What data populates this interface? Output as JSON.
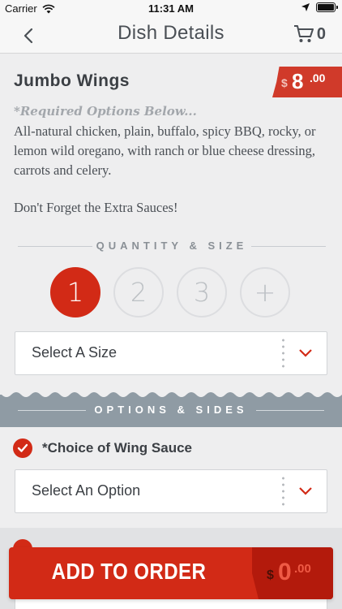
{
  "status_bar": {
    "carrier": "Carrier",
    "time": "11:31 AM"
  },
  "nav": {
    "title": "Dish Details",
    "cart_count": "0"
  },
  "dish": {
    "name": "Jumbo Wings",
    "price_currency": "$",
    "price_whole": "8",
    "price_cents": ".00",
    "required_note": "*Required Options Below...",
    "description": "All-natural chicken, plain, buffalo, spicy BBQ, rocky, or lemon wild oregano, with ranch or blue cheese dressing, carrots and celery.",
    "extra_note": "Don't Forget the Extra Sauces!"
  },
  "quantity": {
    "header": "QUANTITY & SIZE",
    "options": [
      "1",
      "2",
      "3",
      "+"
    ],
    "selected_index": 0,
    "size_select": "Select A Size"
  },
  "options": {
    "header": "OPTIONS & SIDES",
    "wing_sauce_title": "*Choice of Wing Sauce",
    "wing_sauce_select": "Select An Option"
  },
  "order": {
    "button_label": "ADD TO ORDER",
    "price_currency": "$",
    "price_whole": "0",
    "price_cents": ".00"
  },
  "colors": {
    "accent": "#d22a16",
    "banner": "#8f9ba4",
    "background": "#eeeeef"
  }
}
